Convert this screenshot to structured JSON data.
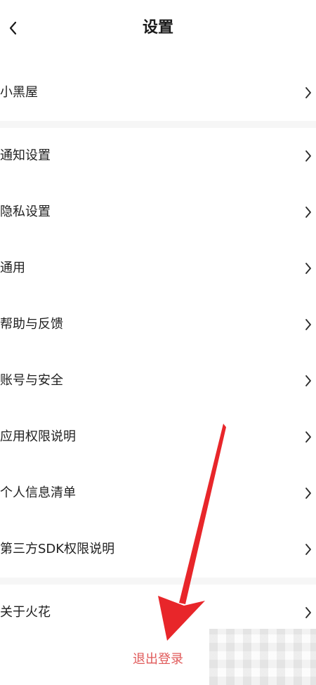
{
  "header": {
    "title": "设置",
    "back_icon": "chevron-left-icon"
  },
  "menu": [
    {
      "label": "小黑屋"
    },
    {
      "label": "通知设置"
    },
    {
      "label": "隐私设置"
    },
    {
      "label": "通用"
    },
    {
      "label": "帮助与反馈"
    },
    {
      "label": "账号与安全"
    },
    {
      "label": "应用权限说明"
    },
    {
      "label": "个人信息清单"
    },
    {
      "label": "第三方SDK权限说明"
    },
    {
      "label": "关于火花"
    }
  ],
  "row_icon": "chevron-right-icon",
  "logout": {
    "label": "退出登录",
    "color": "#e05a5a"
  },
  "annotation": {
    "arrow_color": "#e8262a"
  }
}
